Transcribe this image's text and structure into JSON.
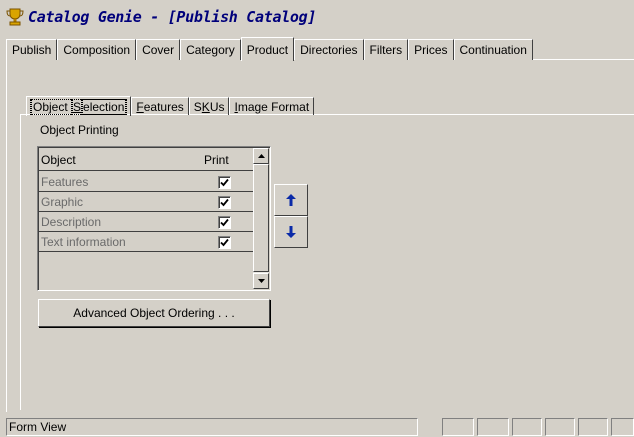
{
  "window": {
    "title": "Catalog Genie  -  [Publish Catalog]",
    "icon": "trophy-icon"
  },
  "main_tabs": [
    {
      "label": "Publish"
    },
    {
      "label": "Composition"
    },
    {
      "label": "Cover"
    },
    {
      "label": "Category"
    },
    {
      "label": "Product",
      "active": true
    },
    {
      "label": "Directories"
    },
    {
      "label": "Filters"
    },
    {
      "label": "Prices"
    },
    {
      "label": "Continuation"
    }
  ],
  "sub_tabs": [
    {
      "label_pre": "Object ",
      "label_ul": "S",
      "label_post": "election",
      "active": true
    },
    {
      "label_pre": "",
      "label_ul": "F",
      "label_post": "eatures"
    },
    {
      "label_pre": "S",
      "label_ul": "K",
      "label_post": "Us"
    },
    {
      "label_pre": "",
      "label_ul": "I",
      "label_post": "mage Format"
    }
  ],
  "object_printing": {
    "group_label": "Object Printing",
    "header_object": "Object",
    "header_print": "Print",
    "rows": [
      {
        "name": "Features",
        "print": true
      },
      {
        "name": "Graphic",
        "print": true
      },
      {
        "name": "Description",
        "print": true
      },
      {
        "name": "Text information",
        "print": true
      }
    ]
  },
  "move_buttons": {
    "up_icon": "arrow-up-icon",
    "down_icon": "arrow-down-icon",
    "color": "#0a2aa8"
  },
  "advanced_button_label": "Advanced Object Ordering . . .",
  "status_bar": {
    "text": "Form View"
  }
}
